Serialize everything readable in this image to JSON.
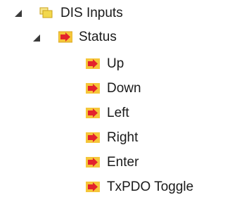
{
  "tree": {
    "root": {
      "label": "DIS Inputs",
      "expanded": true,
      "icon": "folder-icon"
    },
    "group": {
      "label": "Status",
      "expanded": true,
      "icon": "input-variable-icon"
    },
    "items": [
      {
        "label": "Up",
        "icon": "input-variable-icon"
      },
      {
        "label": "Down",
        "icon": "input-variable-icon"
      },
      {
        "label": "Left",
        "icon": "input-variable-icon"
      },
      {
        "label": "Right",
        "icon": "input-variable-icon"
      },
      {
        "label": "Enter",
        "icon": "input-variable-icon"
      },
      {
        "label": "TxPDO Toggle",
        "icon": "input-variable-icon"
      }
    ]
  },
  "colors": {
    "folder_fill": "#f2d84c",
    "folder_edge": "#c9a11a",
    "arrow_bg": "#f5c63a",
    "arrow_red": "#e3222c",
    "expander": "#3a3a3a"
  }
}
